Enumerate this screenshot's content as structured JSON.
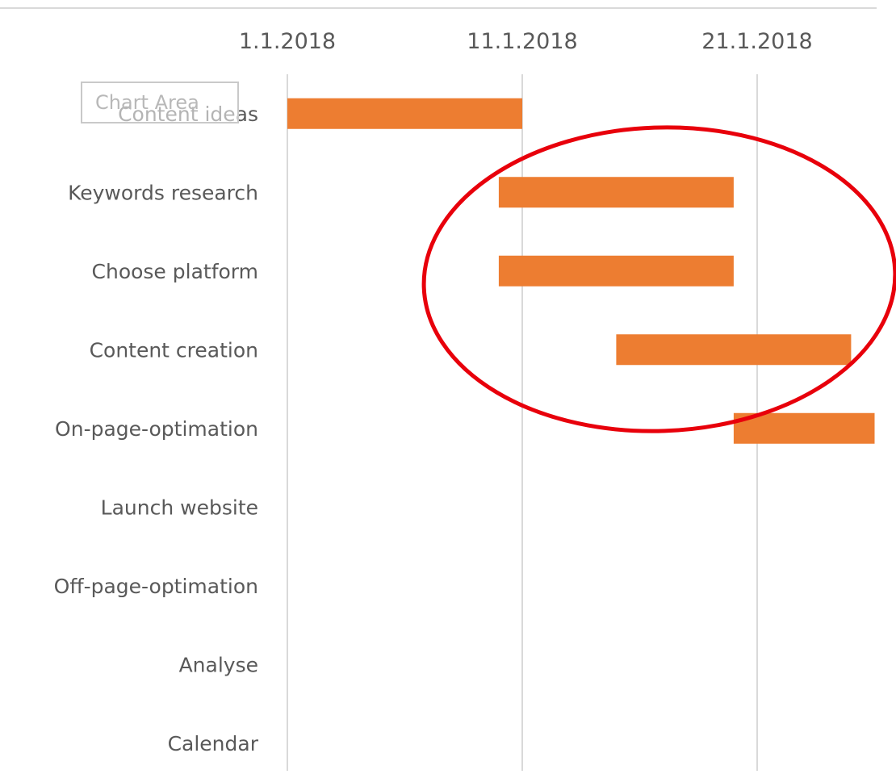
{
  "chart_data": {
    "type": "bar",
    "subtype": "gantt",
    "orientation": "horizontal",
    "title": "",
    "xlabel": "",
    "ylabel": "",
    "x_axis_position": "top",
    "x_ticks": [
      "1.1.2018",
      "11.1.2018",
      "21.1.2018"
    ],
    "xlim": [
      "2018-01-01",
      "2018-01-26"
    ],
    "gridlines": "vertical",
    "bar_color": "#ED7D31",
    "categories": [
      "Content ideas",
      "Keywords research",
      "Choose platform",
      "Content creation",
      "On-page-optimation",
      "Launch website",
      "Off-page-optimation",
      "Analyse",
      "Calendar"
    ],
    "tasks": [
      {
        "name": "Content ideas",
        "start": "2018-01-01",
        "end": "2018-01-11"
      },
      {
        "name": "Keywords research",
        "start": "2018-01-10",
        "end": "2018-01-20"
      },
      {
        "name": "Choose platform",
        "start": "2018-01-10",
        "end": "2018-01-20"
      },
      {
        "name": "Content creation",
        "start": "2018-01-15",
        "end": "2018-01-25"
      },
      {
        "name": "On-page-optimation",
        "start": "2018-01-20",
        "end": "2018-01-26"
      },
      {
        "name": "Launch website",
        "start": null,
        "end": null
      },
      {
        "name": "Off-page-optimation",
        "start": null,
        "end": null
      },
      {
        "name": "Analyse",
        "start": null,
        "end": null
      },
      {
        "name": "Calendar",
        "start": null,
        "end": null
      }
    ]
  },
  "overlay": {
    "tooltip_text": "Chart Area",
    "annotation_color": "#E8000B"
  }
}
